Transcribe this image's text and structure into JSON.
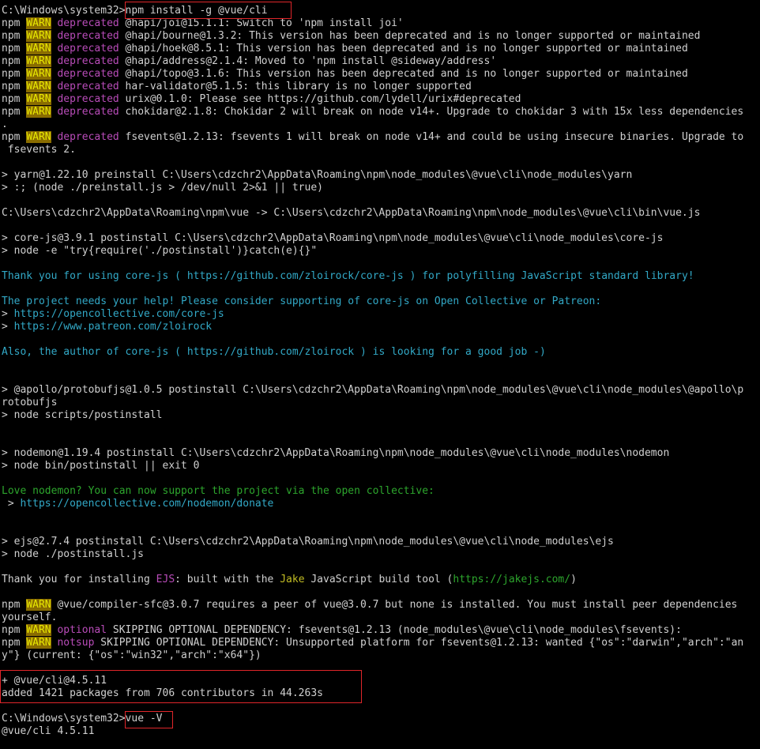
{
  "terminal": {
    "lines": [
      [
        {
          "t": "C:\\Windows\\system32>",
          "c": "gray"
        },
        {
          "t": "npm install -g @vue/cli",
          "c": "gray"
        }
      ],
      [
        {
          "t": "npm ",
          "c": "gray"
        },
        {
          "t": "WARN",
          "c": "warn"
        },
        {
          "t": " deprecated",
          "c": "mag"
        },
        {
          "t": " @hapi/joi@15.1.1: Switch to 'npm install joi'",
          "c": "gray"
        }
      ],
      [
        {
          "t": "npm ",
          "c": "gray"
        },
        {
          "t": "WARN",
          "c": "warn"
        },
        {
          "t": " deprecated",
          "c": "mag"
        },
        {
          "t": " @hapi/bourne@1.3.2: This version has been deprecated and is no longer supported or maintained",
          "c": "gray"
        }
      ],
      [
        {
          "t": "npm ",
          "c": "gray"
        },
        {
          "t": "WARN",
          "c": "warn"
        },
        {
          "t": " deprecated",
          "c": "mag"
        },
        {
          "t": " @hapi/hoek@8.5.1: This version has been deprecated and is no longer supported or maintained",
          "c": "gray"
        }
      ],
      [
        {
          "t": "npm ",
          "c": "gray"
        },
        {
          "t": "WARN",
          "c": "warn"
        },
        {
          "t": " deprecated",
          "c": "mag"
        },
        {
          "t": " @hapi/address@2.1.4: Moved to 'npm install @sideway/address'",
          "c": "gray"
        }
      ],
      [
        {
          "t": "npm ",
          "c": "gray"
        },
        {
          "t": "WARN",
          "c": "warn"
        },
        {
          "t": " deprecated",
          "c": "mag"
        },
        {
          "t": " @hapi/topo@3.1.6: This version has been deprecated and is no longer supported or maintained",
          "c": "gray"
        }
      ],
      [
        {
          "t": "npm ",
          "c": "gray"
        },
        {
          "t": "WARN",
          "c": "warn"
        },
        {
          "t": " deprecated",
          "c": "mag"
        },
        {
          "t": " har-validator@5.1.5: this library is no longer supported",
          "c": "gray"
        }
      ],
      [
        {
          "t": "npm ",
          "c": "gray"
        },
        {
          "t": "WARN",
          "c": "warn"
        },
        {
          "t": " deprecated",
          "c": "mag"
        },
        {
          "t": " urix@0.1.0: Please see https://github.com/lydell/urix#deprecated",
          "c": "gray"
        }
      ],
      [
        {
          "t": "npm ",
          "c": "gray"
        },
        {
          "t": "WARN",
          "c": "warn"
        },
        {
          "t": " deprecated",
          "c": "mag"
        },
        {
          "t": " chokidar@2.1.8: Chokidar 2 will break on node v14+. Upgrade to chokidar 3 with 15x less dependencies",
          "c": "gray"
        }
      ],
      [
        {
          "t": ".",
          "c": "gray"
        }
      ],
      [
        {
          "t": "npm ",
          "c": "gray"
        },
        {
          "t": "WARN",
          "c": "warn"
        },
        {
          "t": " deprecated",
          "c": "mag"
        },
        {
          "t": " fsevents@1.2.13: fsevents 1 will break on node v14+ and could be using insecure binaries. Upgrade to",
          "c": "gray"
        }
      ],
      [
        {
          "t": " fsevents 2.",
          "c": "gray"
        }
      ],
      [],
      [
        {
          "t": "> yarn@1.22.10 preinstall C:\\Users\\cdzchr2\\AppData\\Roaming\\npm\\node_modules\\@vue\\cli\\node_modules\\yarn",
          "c": "gray"
        }
      ],
      [
        {
          "t": "> :; (node ./preinstall.js > /dev/null 2>&1 || true)",
          "c": "gray"
        }
      ],
      [],
      [
        {
          "t": "C:\\Users\\cdzchr2\\AppData\\Roaming\\npm\\vue -> C:\\Users\\cdzchr2\\AppData\\Roaming\\npm\\node_modules\\@vue\\cli\\bin\\vue.js",
          "c": "gray"
        }
      ],
      [],
      [
        {
          "t": "> core-js@3.9.1 postinstall C:\\Users\\cdzchr2\\AppData\\Roaming\\npm\\node_modules\\@vue\\cli\\node_modules\\core-js",
          "c": "gray"
        }
      ],
      [
        {
          "t": "> node -e \"try{require('./postinstall')}catch(e){}\"",
          "c": "gray"
        }
      ],
      [],
      [
        {
          "t": "Thank you for using core-js ( ",
          "c": "cyan"
        },
        {
          "t": "https://github.com/zloirock/core-js",
          "c": "cyan"
        },
        {
          "t": " ) for polyfilling JavaScript standard library!",
          "c": "cyan"
        }
      ],
      [],
      [
        {
          "t": "The project needs your help! Please consider supporting of core-js on Open Collective or Patreon:",
          "c": "cyan"
        }
      ],
      [
        {
          "t": "> ",
          "c": "gray"
        },
        {
          "t": "https://opencollective.com/core-js",
          "c": "cyan"
        }
      ],
      [
        {
          "t": "> ",
          "c": "gray"
        },
        {
          "t": "https://www.patreon.com/zloirock",
          "c": "cyan"
        }
      ],
      [],
      [
        {
          "t": "Also, the author of core-js ( ",
          "c": "cyan"
        },
        {
          "t": "https://github.com/zloirock",
          "c": "cyan"
        },
        {
          "t": " ) is looking for a good job -)",
          "c": "cyan"
        }
      ],
      [],
      [],
      [
        {
          "t": "> @apollo/protobufjs@1.0.5 postinstall C:\\Users\\cdzchr2\\AppData\\Roaming\\npm\\node_modules\\@vue\\cli\\node_modules\\@apollo\\p",
          "c": "gray"
        }
      ],
      [
        {
          "t": "rotobufjs",
          "c": "gray"
        }
      ],
      [
        {
          "t": "> node scripts/postinstall",
          "c": "gray"
        }
      ],
      [],
      [],
      [
        {
          "t": "> nodemon@1.19.4 postinstall C:\\Users\\cdzchr2\\AppData\\Roaming\\npm\\node_modules\\@vue\\cli\\node_modules\\nodemon",
          "c": "gray"
        }
      ],
      [
        {
          "t": "> node bin/postinstall || exit 0",
          "c": "gray"
        }
      ],
      [],
      [
        {
          "t": "Love nodemon? You can now support the project via the open collective:",
          "c": "green"
        }
      ],
      [
        {
          "t": " > ",
          "c": "gray"
        },
        {
          "t": "https://opencollective.com/nodemon/donate",
          "c": "cyan"
        }
      ],
      [],
      [],
      [
        {
          "t": "> ejs@2.7.4 postinstall C:\\Users\\cdzchr2\\AppData\\Roaming\\npm\\node_modules\\@vue\\cli\\node_modules\\ejs",
          "c": "gray"
        }
      ],
      [
        {
          "t": "> node ./postinstall.js",
          "c": "gray"
        }
      ],
      [],
      [
        {
          "t": "Thank you for installing ",
          "c": "gray"
        },
        {
          "t": "EJS",
          "c": "mag"
        },
        {
          "t": ": built with the ",
          "c": "gray"
        },
        {
          "t": "Jake",
          "c": "yel"
        },
        {
          "t": " JavaScript build tool (",
          "c": "gray"
        },
        {
          "t": "https://jakejs.com/",
          "c": "green"
        },
        {
          "t": ")",
          "c": "gray"
        }
      ],
      [],
      [
        {
          "t": "npm ",
          "c": "gray"
        },
        {
          "t": "WARN",
          "c": "warn"
        },
        {
          "t": " @vue/compiler-sfc@3.0.7 requires a peer of vue@3.0.7 but none is installed. You must install peer dependencies",
          "c": "gray"
        }
      ],
      [
        {
          "t": "yourself.",
          "c": "gray"
        }
      ],
      [
        {
          "t": "npm ",
          "c": "gray"
        },
        {
          "t": "WARN",
          "c": "warn"
        },
        {
          "t": " optional",
          "c": "mag"
        },
        {
          "t": " SKIPPING OPTIONAL DEPENDENCY: fsevents@1.2.13 (node_modules\\@vue\\cli\\node_modules\\fsevents):",
          "c": "gray"
        }
      ],
      [
        {
          "t": "npm ",
          "c": "gray"
        },
        {
          "t": "WARN",
          "c": "warn"
        },
        {
          "t": " notsup",
          "c": "mag"
        },
        {
          "t": " SKIPPING OPTIONAL DEPENDENCY: Unsupported platform for fsevents@1.2.13: wanted {\"os\":\"darwin\",\"arch\":\"an",
          "c": "gray"
        }
      ],
      [
        {
          "t": "y\"} (current: {\"os\":\"win32\",\"arch\":\"x64\"})",
          "c": "gray"
        }
      ],
      [],
      [
        {
          "t": "+ @vue/cli@4.5.11",
          "c": "gray"
        }
      ],
      [
        {
          "t": "added 1421 packages from 706 contributors in 44.263s",
          "c": "gray"
        }
      ],
      [],
      [
        {
          "t": "C:\\Windows\\system32>",
          "c": "gray"
        },
        {
          "t": "vue -V",
          "c": "gray"
        }
      ],
      [
        {
          "t": "@vue/cli 4.5.11",
          "c": "gray"
        }
      ]
    ]
  }
}
